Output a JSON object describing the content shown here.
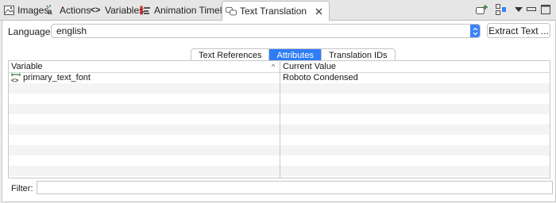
{
  "tabs": [
    {
      "label": "Images",
      "icon": "images-icon"
    },
    {
      "label": "Actions",
      "icon": "actions-icon"
    },
    {
      "label": "Variables",
      "icon": "variables-icon"
    },
    {
      "label": "Animation Timeline",
      "icon": "animation-timeline-icon"
    },
    {
      "label": "Text Translation",
      "icon": "text-translation-icon",
      "active": true
    }
  ],
  "toolbar": {
    "icons": [
      "add-translation-icon",
      "layout-icon",
      "view-menu-icon",
      "minimize-icon",
      "maximize-icon"
    ]
  },
  "language": {
    "label": "Language:",
    "value": "english"
  },
  "extract_button": "Extract Text ...",
  "segments": [
    {
      "label": "Text References"
    },
    {
      "label": "Attributes",
      "active": true
    },
    {
      "label": "Translation IDs"
    }
  ],
  "table": {
    "columns": [
      "Variable",
      "Current Value"
    ],
    "rows": [
      {
        "variable": "primary_text_font",
        "value": "Roboto Condensed"
      }
    ]
  },
  "filter": {
    "label": "Filter:",
    "value": ""
  },
  "colors": {
    "accent": "#2f7df6",
    "background": "#ececec",
    "panel": "#ffffff",
    "alt_row": "#f4f4f4"
  }
}
